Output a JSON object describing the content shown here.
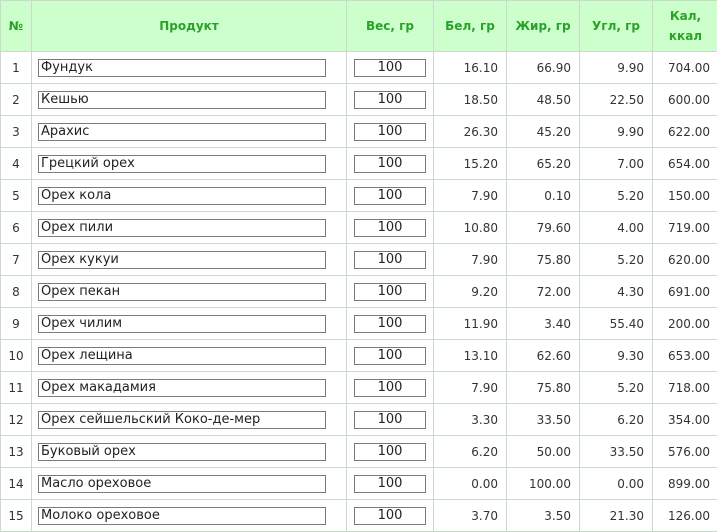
{
  "headers": {
    "num": "№",
    "product": "Продукт",
    "weight": "Вес, гр",
    "protein": "Бел, гр",
    "fat": "Жир, гр",
    "carbs": "Угл, гр",
    "cal_line1": "Кал,",
    "cal_line2": "ккал"
  },
  "rows": [
    {
      "num": "1",
      "name": "Фундук",
      "weight": "100",
      "protein": "16.10",
      "fat": "66.90",
      "carbs": "9.90",
      "cal": "704.00"
    },
    {
      "num": "2",
      "name": "Кешью",
      "weight": "100",
      "protein": "18.50",
      "fat": "48.50",
      "carbs": "22.50",
      "cal": "600.00"
    },
    {
      "num": "3",
      "name": "Арахис",
      "weight": "100",
      "protein": "26.30",
      "fat": "45.20",
      "carbs": "9.90",
      "cal": "622.00"
    },
    {
      "num": "4",
      "name": "Грецкий орех",
      "weight": "100",
      "protein": "15.20",
      "fat": "65.20",
      "carbs": "7.00",
      "cal": "654.00"
    },
    {
      "num": "5",
      "name": "Орех кола",
      "weight": "100",
      "protein": "7.90",
      "fat": "0.10",
      "carbs": "5.20",
      "cal": "150.00"
    },
    {
      "num": "6",
      "name": "Орех пили",
      "weight": "100",
      "protein": "10.80",
      "fat": "79.60",
      "carbs": "4.00",
      "cal": "719.00"
    },
    {
      "num": "7",
      "name": "Орех кукуи",
      "weight": "100",
      "protein": "7.90",
      "fat": "75.80",
      "carbs": "5.20",
      "cal": "620.00"
    },
    {
      "num": "8",
      "name": "Орех пекан",
      "weight": "100",
      "protein": "9.20",
      "fat": "72.00",
      "carbs": "4.30",
      "cal": "691.00"
    },
    {
      "num": "9",
      "name": "Орех чилим",
      "weight": "100",
      "protein": "11.90",
      "fat": "3.40",
      "carbs": "55.40",
      "cal": "200.00"
    },
    {
      "num": "10",
      "name": "Орех лещина",
      "weight": "100",
      "protein": "13.10",
      "fat": "62.60",
      "carbs": "9.30",
      "cal": "653.00"
    },
    {
      "num": "11",
      "name": "Орех макадамия",
      "weight": "100",
      "protein": "7.90",
      "fat": "75.80",
      "carbs": "5.20",
      "cal": "718.00"
    },
    {
      "num": "12",
      "name": "Орех сейшельский Коко-де-мер",
      "weight": "100",
      "protein": "3.30",
      "fat": "33.50",
      "carbs": "6.20",
      "cal": "354.00"
    },
    {
      "num": "13",
      "name": "Буковый орех",
      "weight": "100",
      "protein": "6.20",
      "fat": "50.00",
      "carbs": "33.50",
      "cal": "576.00"
    },
    {
      "num": "14",
      "name": "Масло ореховое",
      "weight": "100",
      "protein": "0.00",
      "fat": "100.00",
      "carbs": "0.00",
      "cal": "899.00"
    },
    {
      "num": "15",
      "name": "Молоко ореховое",
      "weight": "100",
      "protein": "3.70",
      "fat": "3.50",
      "carbs": "21.30",
      "cal": "126.00"
    }
  ],
  "colors": {
    "header_bg": "#ccffcc",
    "header_text": "#2aa22a",
    "grid": "#c9dcc9"
  }
}
